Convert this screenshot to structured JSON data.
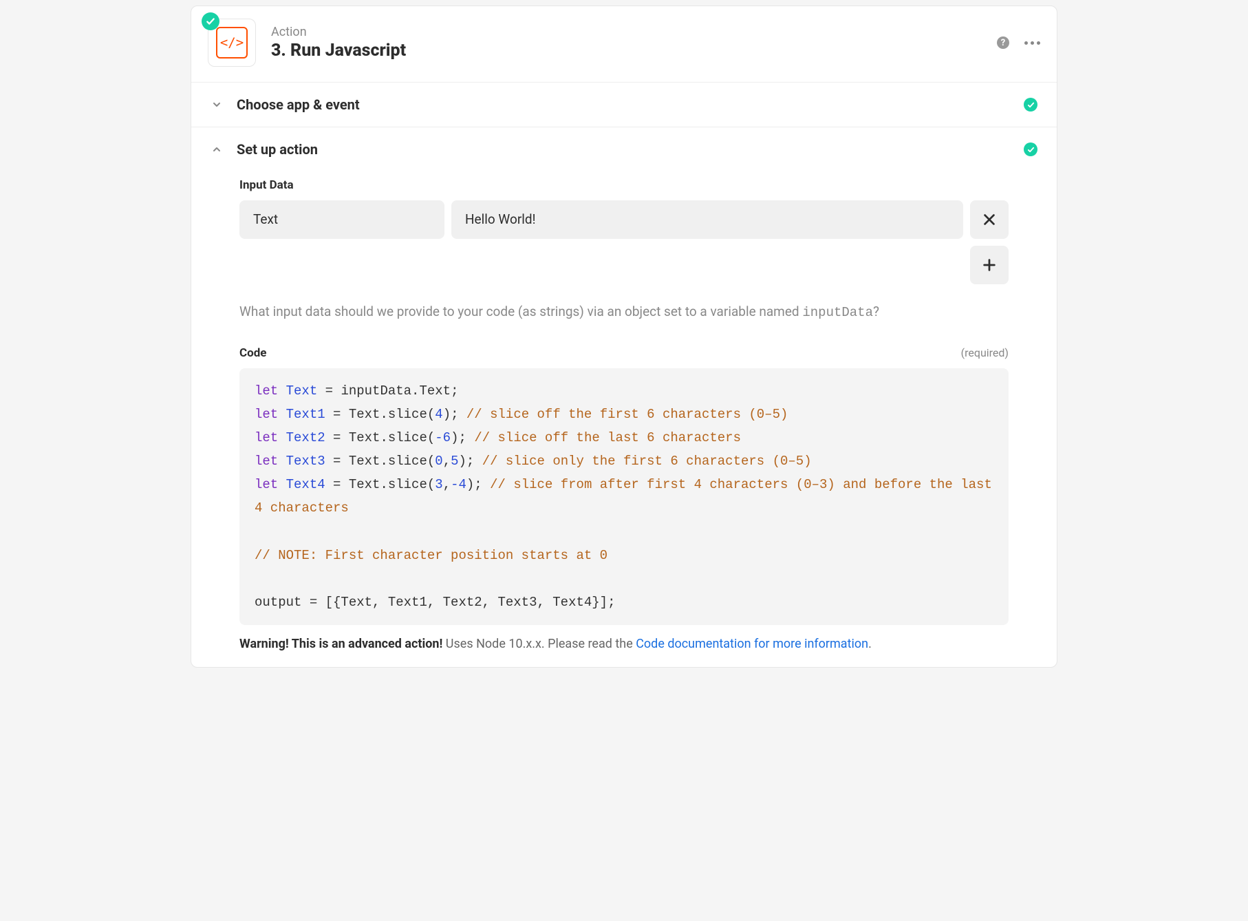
{
  "header": {
    "subtitle": "Action",
    "title": "3. Run Javascript",
    "app_icon_text": "</>"
  },
  "sections": {
    "choose": {
      "label": "Choose app & event"
    },
    "setup": {
      "label": "Set up action"
    }
  },
  "setup": {
    "input_data_label": "Input Data",
    "row": {
      "key": "Text",
      "value": "Hello World!"
    },
    "help_prefix": "What input data should we provide to your code (as strings) via an object set to a variable named ",
    "help_code": "inputData",
    "help_suffix": "?",
    "code_label": "Code",
    "code_required": "(required)",
    "code": {
      "l1_pre": "let",
      "l1_var": "Text",
      "l1_rest": " = inputData.Text;",
      "l2_pre": "let",
      "l2_var": "Text1",
      "l2_mid": " = Text.slice(",
      "l2_num": "4",
      "l2_end": "); ",
      "l2_cm": "// slice off the first 6 characters (0–5)",
      "l3_pre": "let",
      "l3_var": "Text2",
      "l3_mid": " = Text.slice(",
      "l3_num": "-6",
      "l3_end": "); ",
      "l3_cm": "// slice off the last 6 characters",
      "l4_pre": "let",
      "l4_var": "Text3",
      "l4_mid": " = Text.slice(",
      "l4_n1": "0",
      "l4_c": ",",
      "l4_n2": "5",
      "l4_end": "); ",
      "l4_cm": "// slice only the first 6 characters (0–5)",
      "l5_pre": "let",
      "l5_var": "Text4",
      "l5_mid": " = Text.slice(",
      "l5_n1": "3",
      "l5_c": ",",
      "l5_n2": "-4",
      "l5_end": "); ",
      "l5_cm": "// slice from after first 4 characters (0–3) and before the last 4 characters",
      "note": "// NOTE: First character position starts at 0",
      "out": "output = [{Text, Text1, Text2, Text3, Text4}];"
    },
    "warning_bold": "Warning! This is an advanced action!",
    "warning_text": " Uses Node 10.x.x. Please read the ",
    "warning_link": "Code documentation for more information",
    "warning_after": "."
  }
}
